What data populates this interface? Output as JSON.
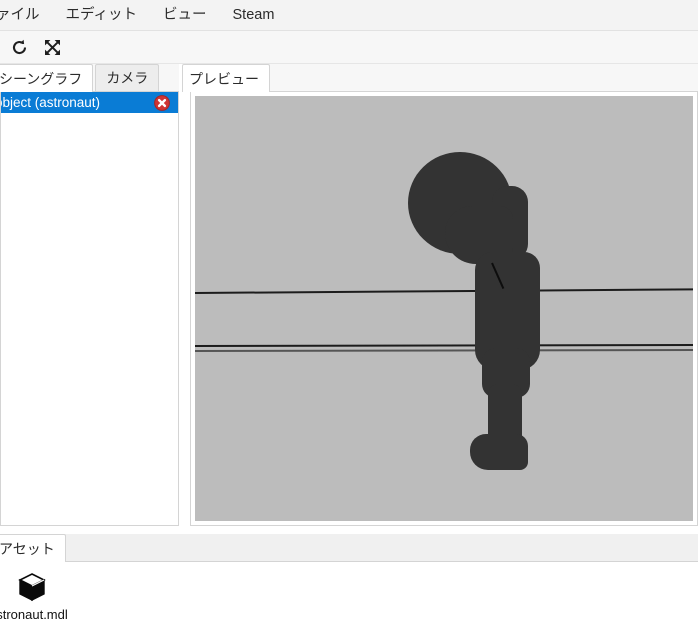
{
  "window": {
    "background": "#ffffff",
    "accent": "#0a7cd5"
  },
  "menubar": {
    "items": [
      {
        "label": "ァイル",
        "name": "menu-file"
      },
      {
        "label": "エディット",
        "name": "menu-edit"
      },
      {
        "label": "ビュー",
        "name": "menu-view"
      },
      {
        "label": "Steam",
        "name": "menu-steam"
      }
    ]
  },
  "toolbar": {
    "buttons": [
      {
        "icon": "refresh-icon",
        "title": "Reload"
      },
      {
        "icon": "fullscreen-icon",
        "title": "Fullscreen"
      }
    ]
  },
  "left_panel": {
    "tabs": [
      {
        "label": "シーングラフ",
        "active": true
      },
      {
        "label": "カメラ",
        "active": false
      }
    ],
    "tree": {
      "items": [
        {
          "label": "object (astronaut)",
          "selected": true,
          "delete_icon": "delete-circle-icon"
        }
      ]
    }
  },
  "right_panel": {
    "tabs": [
      {
        "label": "プレビュー",
        "active": true
      }
    ],
    "viewport": {
      "background": "#bcbcbc",
      "model_color": "#333333",
      "model_name": "astronaut"
    }
  },
  "bottom_panel": {
    "tabs": [
      {
        "label": "アセット",
        "active": true
      }
    ],
    "assets": [
      {
        "label": "stronaut.mdl",
        "icon": "cube-icon"
      }
    ]
  }
}
